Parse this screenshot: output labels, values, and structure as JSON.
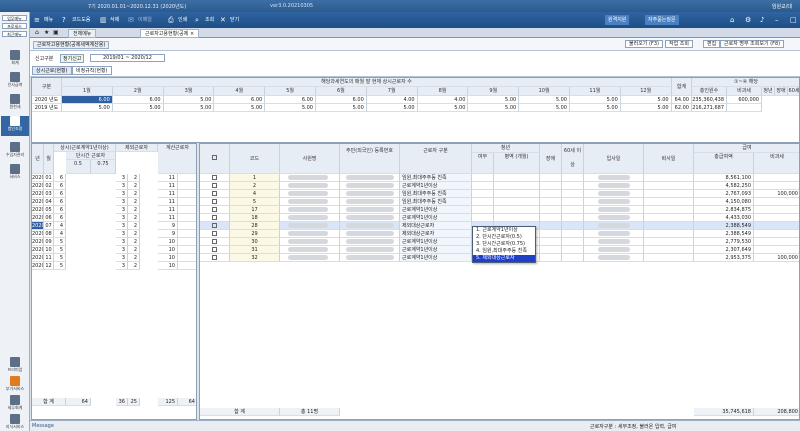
{
  "app": {
    "title": "7기 2020.01.01~2020.12.31 (2020년도)",
    "version": "ver3.0.20210305",
    "right_status": "임원교/대"
  },
  "toolbar": {
    "menu": "메뉴",
    "code": "코드도움",
    "delete": "삭제",
    "mail": "이메일",
    "print": "인쇄",
    "search": "조회",
    "close": "닫기",
    "right1": "원격지원",
    "right2": "자주묻는질문"
  },
  "leftnav": {
    "btn1": "업무메뉴",
    "btn2": "프로세스",
    "btn3": "최근메뉴",
    "items": [
      "회계",
      "인사급여",
      "원천세",
      "법인조정",
      "수입지관리",
      "서비스",
      "프리미엄",
      "부가서비스",
      "세무회계",
      "지식서비스"
    ]
  },
  "tabs": {
    "all_menu": "전체메뉴",
    "current": "근로자고용현황(공제"
  },
  "page": {
    "title": "근로자고용현황(공제세액계산용)",
    "btn_load": "불러오기 (F3)",
    "btn_cancel": "작업 조회",
    "btn_edit": "편집",
    "btn_report": "근로자 명부 조회보기 (F8)"
  },
  "filter": {
    "label": "신고구분",
    "value": "정기신고",
    "period": "2019/01 ~ 2020/12",
    "tab1": "상시근로(현황)",
    "tab2": "비정규직(현황)"
  },
  "top_table": {
    "h_group": "해당과세연도의 매월 말 현재 상시근로자 수",
    "h_type": "구분",
    "h_sum": "합계",
    "h_total": "총인원수",
    "h_excl": "비과세",
    "h_extra": "①~④ 해당",
    "h_young": "청년",
    "h_old": "장애",
    "h_60": "60세",
    "months": [
      "1월",
      "2월",
      "3월",
      "4월",
      "5월",
      "6월",
      "7월",
      "8월",
      "9월",
      "10월",
      "11월",
      "12월"
    ],
    "rows": [
      {
        "label": "2020 년도",
        "vals": [
          "6.00",
          "6.00",
          "5.00",
          "6.00",
          "6.00",
          "6.00",
          "4.00",
          "4.00",
          "5.00",
          "5.00",
          "5.00",
          "5.00"
        ],
        "sum": "64.00",
        "total": "235,360,438",
        "excl": "600,000"
      },
      {
        "label": "2019 년도",
        "vals": [
          "5.00",
          "5.00",
          "5.00",
          "5.00",
          "5.00",
          "5.00",
          "5.00",
          "5.00",
          "5.00",
          "5.00",
          "5.00",
          "5.00"
        ],
        "sum": "62.00",
        "total": "216,271,687",
        "excl": ""
      }
    ]
  },
  "left_table": {
    "h_year": "년",
    "h_month": "월",
    "h_total": "상시(근로계약1년이상)",
    "h_short": "단시간 근로자",
    "h_s1": "0.5",
    "h_s2": "0.75",
    "h_excl": "제외근로자",
    "h_calc": "계산근로자",
    "rows": [
      [
        "2020",
        "01",
        "6",
        "3",
        "2",
        "11"
      ],
      [
        "2020",
        "02",
        "6",
        "3",
        "2",
        "11"
      ],
      [
        "2020",
        "03",
        "6",
        "3",
        "2",
        "11"
      ],
      [
        "2020",
        "04",
        "6",
        "3",
        "2",
        "11"
      ],
      [
        "2020",
        "05",
        "6",
        "3",
        "2",
        "11"
      ],
      [
        "2020",
        "06",
        "6",
        "3",
        "2",
        "11"
      ],
      [
        "2020",
        "07",
        "4",
        "3",
        "2",
        "9"
      ],
      [
        "2020",
        "08",
        "4",
        "3",
        "2",
        "9"
      ],
      [
        "2020",
        "09",
        "5",
        "3",
        "2",
        "10"
      ],
      [
        "2020",
        "10",
        "5",
        "3",
        "2",
        "10"
      ],
      [
        "2020",
        "11",
        "5",
        "3",
        "2",
        "10"
      ],
      [
        "2020",
        "12",
        "5",
        "3",
        "2",
        "10"
      ]
    ],
    "total_label": "합 계",
    "total_vals": [
      "64",
      "36",
      "25",
      "125",
      "64"
    ]
  },
  "right_table": {
    "h_check": "",
    "h_code": "코드",
    "h_name": "사원명",
    "h_resid": "주민(외국인) 등록번호",
    "h_type": "근로자 구분",
    "h_young": "청년",
    "h_young1": "여부",
    "h_young2": "병역 (개월)",
    "h_disable": "장애",
    "h_60": "60세 이상",
    "h_in": "입사일",
    "h_out": "퇴사일",
    "h_pay": "급여",
    "h_paytotal": "총급여액",
    "h_nontax": "비과세",
    "rows": [
      {
        "code": "1",
        "type": "임원,최대주주등 친족",
        "pay": "8,561,100",
        "nontax": ""
      },
      {
        "code": "2",
        "type": "근로계약1년이상",
        "pay": "4,582,250",
        "nontax": ""
      },
      {
        "code": "4",
        "type": "임원,최대주주등 친족",
        "pay": "2,767,093",
        "nontax": "100,000"
      },
      {
        "code": "5",
        "type": "임원,최대주주등 친족",
        "pay": "4,150,080",
        "nontax": ""
      },
      {
        "code": "17",
        "type": "근로계약1년이상",
        "pay": "2,834,875",
        "nontax": ""
      },
      {
        "code": "18",
        "type": "근로계약1년이상",
        "pay": "4,433,030",
        "nontax": ""
      },
      {
        "code": "28",
        "type": "제외대상근로자",
        "pay": "2,388,549",
        "nontax": ""
      },
      {
        "code": "29",
        "type": "제외대상근로자",
        "pay": "2,388,549",
        "nontax": ""
      },
      {
        "code": "30",
        "type": "근로계약1년이상",
        "pay": "2,779,530",
        "nontax": ""
      },
      {
        "code": "31",
        "type": "근로계약1년이상",
        "pay": "2,307,649",
        "nontax": ""
      },
      {
        "code": "32",
        "type": "근로계약1년이상",
        "pay": "2,953,375",
        "nontax": "100,000"
      }
    ],
    "total_label": "합 계",
    "total_count": "총 11명",
    "total_pay": "35,745,618",
    "total_nontax": "208,800"
  },
  "dropdown": {
    "options": [
      "1. 근로계약1년이상",
      "2. 단시간근로자(0.5)",
      "3. 단시간근로자(0.75)",
      "4. 임원,최대주주등 친족",
      "5. 제외대상근로자"
    ],
    "selected": 4
  },
  "footer": {
    "msg": "Message",
    "hint": "근로자구분 : 세무조정, 불러온 입력, 급여"
  },
  "colors": {
    "accent": "#2f64a0",
    "selected": "#1f3fc9"
  }
}
